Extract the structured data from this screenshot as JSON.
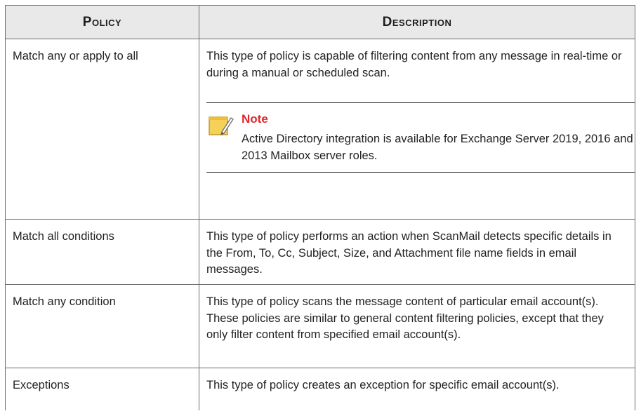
{
  "table": {
    "headers": {
      "policy": "Policy",
      "description": "Description"
    },
    "rows": [
      {
        "policy": "Match any or apply to all",
        "description": "This type of policy is capable of filtering content from any message in real-time or during a manual or scheduled scan.",
        "note": {
          "title": "Note",
          "text": "Active Directory integration is available for Exchange Server 2019, 2016 and 2013 Mailbox server roles.",
          "icon": "note-pad-pencil-icon"
        }
      },
      {
        "policy": "Match all conditions",
        "description": "This type of policy performs an action when ScanMail detects specific details in the From, To, Cc, Subject, Size, and Attachment file name fields in email messages."
      },
      {
        "policy": "Match any condition",
        "description": "This type of policy scans the message content of particular email account(s). These policies are similar to general content filtering policies, except that they only filter content from specified email account(s)."
      },
      {
        "policy": "Exceptions",
        "description": "This type of policy creates an exception for specific email account(s)."
      }
    ]
  },
  "colors": {
    "header_bg": "#e9e9e9",
    "border": "#6b6b6b",
    "note_title": "#e3262b",
    "note_icon_fill": "#f6d15a"
  }
}
